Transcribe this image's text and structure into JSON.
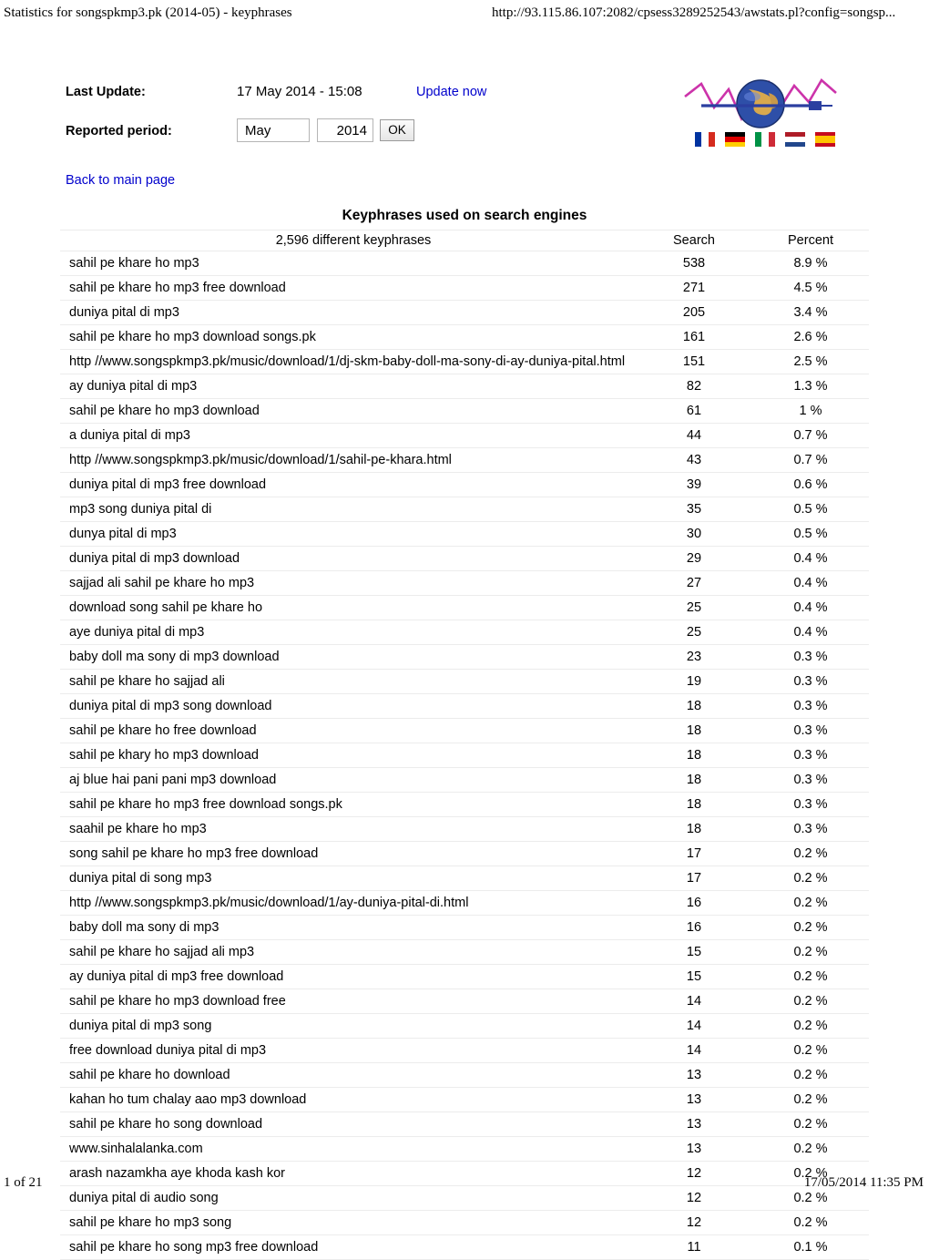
{
  "browser": {
    "header_title": "Statistics for songspkmp3.pk (2014-05) - keyphrases",
    "header_url": "http://93.115.86.107:2082/cpsess3289252543/awstats.pl?config=songsp...",
    "footer_page": "1 of 21",
    "footer_timestamp": "17/05/2014 11:35 PM"
  },
  "meta": {
    "last_update_label": "Last Update:",
    "last_update_value": "17 May 2014 - 15:08",
    "update_now_label": "Update now",
    "reported_period_label": "Reported period:",
    "month_value": "May",
    "year_value": "2014",
    "ok_label": "OK",
    "back_link_label": "Back to main page"
  },
  "logo": {
    "alt": "AWStats globe logo",
    "flags": [
      {
        "name": "flag-fr",
        "stripes": [
          "#0033a0",
          "#ffffff",
          "#d52b1e"
        ],
        "orientation": "vertical"
      },
      {
        "name": "flag-de",
        "stripes": [
          "#000000",
          "#dd0000",
          "#ffce00"
        ],
        "orientation": "horizontal"
      },
      {
        "name": "flag-it",
        "stripes": [
          "#009246",
          "#ffffff",
          "#ce2b37"
        ],
        "orientation": "vertical"
      },
      {
        "name": "flag-nl",
        "stripes": [
          "#ae1c28",
          "#ffffff",
          "#21468b"
        ],
        "orientation": "horizontal"
      },
      {
        "name": "flag-es",
        "stripes": [
          "#c60b1e",
          "#ffc400",
          "#c60b1e"
        ],
        "orientation": "horizontal"
      }
    ]
  },
  "report": {
    "title": "Keyphrases used on search engines",
    "columns": {
      "keyphrase": "2,596 different keyphrases",
      "search": "Search",
      "percent": "Percent"
    },
    "rows": [
      {
        "keyphrase": "sahil pe khare ho mp3",
        "search": "538",
        "percent": "8.9 %"
      },
      {
        "keyphrase": "sahil pe khare ho mp3 free download",
        "search": "271",
        "percent": "4.5 %"
      },
      {
        "keyphrase": "duniya pital di mp3",
        "search": "205",
        "percent": "3.4 %"
      },
      {
        "keyphrase": "sahil pe khare ho mp3 download songs.pk",
        "search": "161",
        "percent": "2.6 %"
      },
      {
        "keyphrase": "http //www.songspkmp3.pk/music/download/1/dj-skm-baby-doll-ma-sony-di-ay-duniya-pital.html",
        "search": "151",
        "percent": "2.5 %"
      },
      {
        "keyphrase": "ay duniya pital di mp3",
        "search": "82",
        "percent": "1.3 %"
      },
      {
        "keyphrase": "sahil pe khare ho mp3 download",
        "search": "61",
        "percent": "1 %"
      },
      {
        "keyphrase": "a duniya pital di mp3",
        "search": "44",
        "percent": "0.7 %"
      },
      {
        "keyphrase": "http //www.songspkmp3.pk/music/download/1/sahil-pe-khara.html",
        "search": "43",
        "percent": "0.7 %"
      },
      {
        "keyphrase": "duniya pital di mp3 free download",
        "search": "39",
        "percent": "0.6 %"
      },
      {
        "keyphrase": "mp3 song duniya pital di",
        "search": "35",
        "percent": "0.5 %"
      },
      {
        "keyphrase": "dunya pital di mp3",
        "search": "30",
        "percent": "0.5 %"
      },
      {
        "keyphrase": "duniya pital di mp3 download",
        "search": "29",
        "percent": "0.4 %"
      },
      {
        "keyphrase": "sajjad ali sahil pe khare ho mp3",
        "search": "27",
        "percent": "0.4 %"
      },
      {
        "keyphrase": "download song sahil pe khare ho",
        "search": "25",
        "percent": "0.4 %"
      },
      {
        "keyphrase": "aye duniya pital di mp3",
        "search": "25",
        "percent": "0.4 %"
      },
      {
        "keyphrase": "baby doll ma sony di mp3 download",
        "search": "23",
        "percent": "0.3 %"
      },
      {
        "keyphrase": "sahil pe khare ho sajjad ali",
        "search": "19",
        "percent": "0.3 %"
      },
      {
        "keyphrase": "duniya pital di mp3 song download",
        "search": "18",
        "percent": "0.3 %"
      },
      {
        "keyphrase": "sahil pe khare ho free download",
        "search": "18",
        "percent": "0.3 %"
      },
      {
        "keyphrase": "sahil pe khary ho mp3 download",
        "search": "18",
        "percent": "0.3 %"
      },
      {
        "keyphrase": "aj blue hai pani pani mp3 download",
        "search": "18",
        "percent": "0.3 %"
      },
      {
        "keyphrase": "sahil pe khare ho mp3 free download songs.pk",
        "search": "18",
        "percent": "0.3 %"
      },
      {
        "keyphrase": "saahil pe khare ho mp3",
        "search": "18",
        "percent": "0.3 %"
      },
      {
        "keyphrase": "song sahil pe khare ho mp3 free download",
        "search": "17",
        "percent": "0.2 %"
      },
      {
        "keyphrase": "duniya pital di song mp3",
        "search": "17",
        "percent": "0.2 %"
      },
      {
        "keyphrase": "http //www.songspkmp3.pk/music/download/1/ay-duniya-pital-di.html",
        "search": "16",
        "percent": "0.2 %"
      },
      {
        "keyphrase": "baby doll ma sony di mp3",
        "search": "16",
        "percent": "0.2 %"
      },
      {
        "keyphrase": "sahil pe khare ho sajjad ali mp3",
        "search": "15",
        "percent": "0.2 %"
      },
      {
        "keyphrase": "ay duniya pital di mp3 free download",
        "search": "15",
        "percent": "0.2 %"
      },
      {
        "keyphrase": "sahil pe khare ho mp3 download free",
        "search": "14",
        "percent": "0.2 %"
      },
      {
        "keyphrase": "duniya pital di mp3 song",
        "search": "14",
        "percent": "0.2 %"
      },
      {
        "keyphrase": "free download duniya pital di mp3",
        "search": "14",
        "percent": "0.2 %"
      },
      {
        "keyphrase": "sahil pe khare ho download",
        "search": "13",
        "percent": "0.2 %"
      },
      {
        "keyphrase": "kahan ho tum chalay aao mp3 download",
        "search": "13",
        "percent": "0.2 %"
      },
      {
        "keyphrase": "sahil pe khare ho song download",
        "search": "13",
        "percent": "0.2 %"
      },
      {
        "keyphrase": "www.sinhalalanka.com",
        "search": "13",
        "percent": "0.2 %"
      },
      {
        "keyphrase": "arash nazamkha aye khoda kash kor",
        "search": "12",
        "percent": "0.2 %"
      },
      {
        "keyphrase": "duniya pital di audio song",
        "search": "12",
        "percent": "0.2 %"
      },
      {
        "keyphrase": "sahil pe khare ho mp3 song",
        "search": "12",
        "percent": "0.2 %"
      },
      {
        "keyphrase": "sahil pe khare ho song mp3 free download",
        "search": "11",
        "percent": "0.1 %"
      }
    ]
  }
}
